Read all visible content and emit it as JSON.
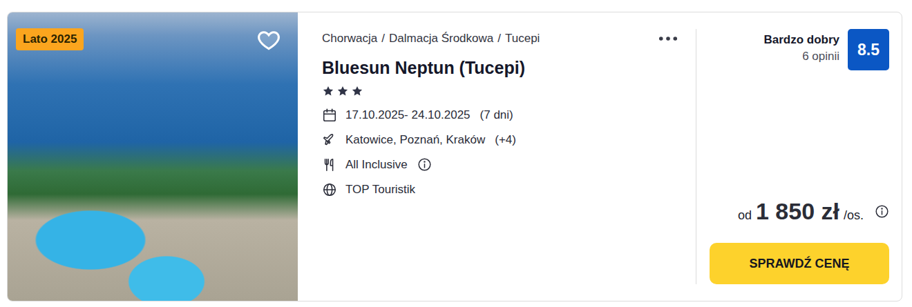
{
  "badge": "Lato 2025",
  "favorite": false,
  "breadcrumb": {
    "items": [
      "Chorwacja",
      "Dalmacja Środkowa",
      "Tucepi"
    ],
    "separator": "/"
  },
  "title": "Bluesun Neptun (Tucepi)",
  "stars": 3,
  "details": [
    {
      "kind": "dates",
      "text": "17.10.2025- 24.10.2025",
      "extra": "(7 dni)",
      "info": false
    },
    {
      "kind": "flight",
      "text": "Katowice, Poznań, Kraków",
      "extra": "(+4)",
      "info": false
    },
    {
      "kind": "board",
      "text": "All Inclusive",
      "extra": "",
      "info": true
    },
    {
      "kind": "operator",
      "text": "TOP Touristik",
      "extra": "",
      "info": false
    }
  ],
  "rating": {
    "label": "Bardzo dobry",
    "reviews": "6 opinii",
    "score": "8.5"
  },
  "price": {
    "prefix": "od",
    "amount": "1 850 zł",
    "suffix": "/os."
  },
  "button": "SPRAWDŹ CENĘ"
}
